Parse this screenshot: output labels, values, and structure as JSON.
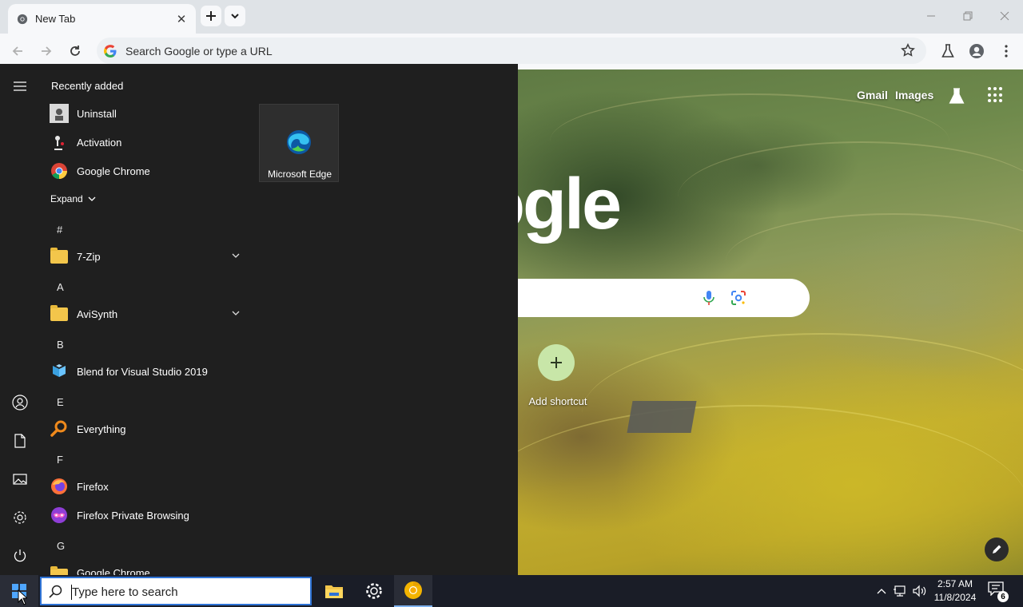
{
  "browser": {
    "tab_title": "New Tab",
    "omnibox_placeholder": "Search Google or type a URL"
  },
  "ntp": {
    "gmail": "Gmail",
    "images": "Images",
    "logo_visible": "ogle",
    "add_shortcut": "Add shortcut"
  },
  "start_menu": {
    "recently_added_header": "Recently added",
    "recent": [
      "Uninstall",
      "Activation",
      "Google Chrome"
    ],
    "expand": "Expand",
    "letters": [
      "#",
      "A",
      "B",
      "E",
      "F",
      "G"
    ],
    "apps": {
      "zip": "7-Zip",
      "avisynth": "AviSynth",
      "blend": "Blend for Visual Studio 2019",
      "everything": "Everything",
      "firefox": "Firefox",
      "firefox_private": "Firefox Private Browsing",
      "chrome_folder": "Google Chrome"
    },
    "tile_edge": "Microsoft Edge"
  },
  "taskbar": {
    "search_placeholder": "Type here to search",
    "time": "2:57 AM",
    "date": "11/8/2024",
    "notification_count": "6"
  },
  "colors": {
    "start_bg": "#1f1f1f",
    "taskbar_bg": "#1a1d27",
    "accent": "#2e73d6",
    "shortcut_bg": "#c8e6a8"
  }
}
